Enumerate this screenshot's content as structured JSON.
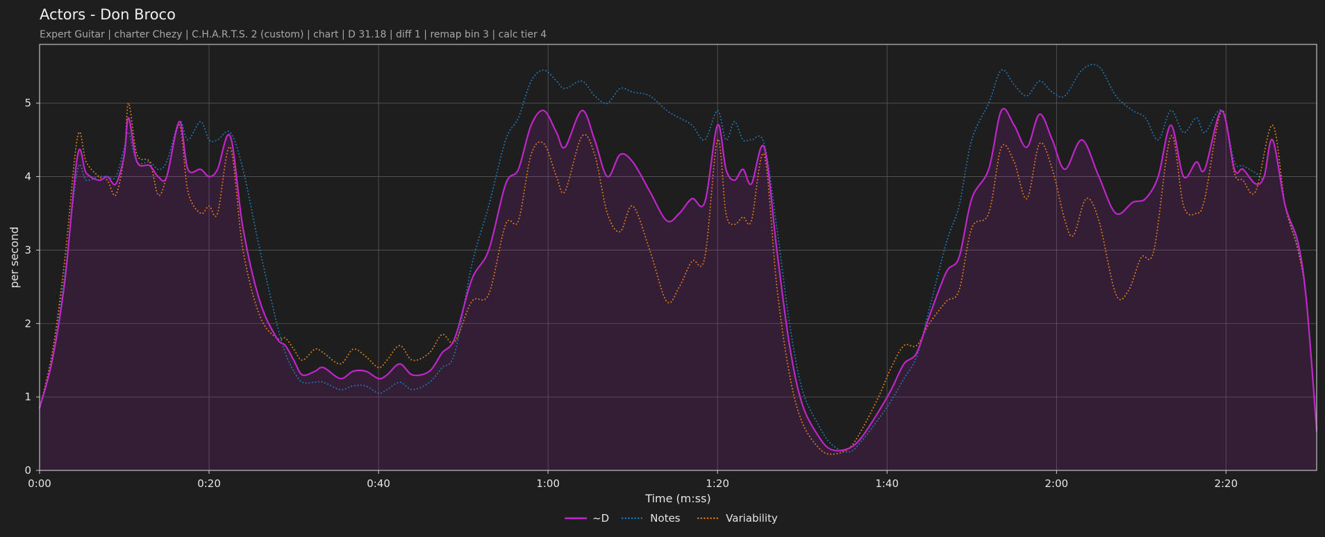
{
  "page": {
    "title": "Actors - Don Broco",
    "subtitle": "Expert Guitar  |  charter Chezy  |  C.H.A.R.T.S. 2 (custom)  |  chart  |  D 31.18  |  diff 1  |  remap bin 3  |  calc tier 4"
  },
  "chart_data": {
    "type": "line",
    "xlabel": "Time (m:ss)",
    "ylabel": "per second",
    "xlim": [
      0,
      150.7
    ],
    "ylim": [
      0,
      5.8
    ],
    "x_ticks": [
      0,
      20,
      40,
      60,
      80,
      100,
      120,
      140
    ],
    "x_tick_labels": [
      "0:00",
      "0:20",
      "0:40",
      "1:00",
      "1:20",
      "1:40",
      "2:00",
      "2:20"
    ],
    "y_ticks": [
      0,
      1,
      2,
      3,
      4,
      5
    ],
    "y_tick_labels": [
      "0",
      "1",
      "2",
      "3",
      "4",
      "5"
    ],
    "grid": true,
    "legend_position": "bottom-center",
    "series": [
      {
        "name": "~D",
        "color": "#c026c9",
        "style": "solid",
        "fill": true,
        "points": [
          [
            0,
            0.85
          ],
          [
            1.5,
            1.5
          ],
          [
            3,
            2.6
          ],
          [
            4.5,
            4.3
          ],
          [
            5.5,
            4.05
          ],
          [
            7,
            3.95
          ],
          [
            8,
            4.0
          ],
          [
            9,
            3.9
          ],
          [
            10,
            4.3
          ],
          [
            10.5,
            4.8
          ],
          [
            11.5,
            4.2
          ],
          [
            13,
            4.15
          ],
          [
            14,
            4.0
          ],
          [
            15,
            4.0
          ],
          [
            16.5,
            4.75
          ],
          [
            17.5,
            4.1
          ],
          [
            19,
            4.1
          ],
          [
            20,
            4.0
          ],
          [
            21,
            4.1
          ],
          [
            22.5,
            4.55
          ],
          [
            24,
            3.3
          ],
          [
            26,
            2.3
          ],
          [
            28,
            1.8
          ],
          [
            29,
            1.7
          ],
          [
            30,
            1.5
          ],
          [
            31,
            1.3
          ],
          [
            32.5,
            1.35
          ],
          [
            33.5,
            1.4
          ],
          [
            35.5,
            1.25
          ],
          [
            37,
            1.35
          ],
          [
            38.5,
            1.35
          ],
          [
            40,
            1.25
          ],
          [
            41,
            1.3
          ],
          [
            42.5,
            1.45
          ],
          [
            44,
            1.3
          ],
          [
            46,
            1.35
          ],
          [
            47.5,
            1.6
          ],
          [
            49,
            1.8
          ],
          [
            51,
            2.6
          ],
          [
            53,
            3.0
          ],
          [
            55,
            3.9
          ],
          [
            56.5,
            4.1
          ],
          [
            58,
            4.7
          ],
          [
            59.5,
            4.9
          ],
          [
            61,
            4.6
          ],
          [
            62,
            4.4
          ],
          [
            64,
            4.9
          ],
          [
            65.5,
            4.5
          ],
          [
            67,
            4.0
          ],
          [
            68.5,
            4.3
          ],
          [
            70,
            4.2
          ],
          [
            72,
            3.8
          ],
          [
            74,
            3.4
          ],
          [
            75.5,
            3.5
          ],
          [
            77,
            3.7
          ],
          [
            78.5,
            3.65
          ],
          [
            80,
            4.7
          ],
          [
            81,
            4.1
          ],
          [
            82,
            3.95
          ],
          [
            83,
            4.1
          ],
          [
            84,
            3.9
          ],
          [
            85.5,
            4.4
          ],
          [
            87,
            3.0
          ],
          [
            88.5,
            1.7
          ],
          [
            90,
            0.9
          ],
          [
            92,
            0.45
          ],
          [
            93.5,
            0.28
          ],
          [
            95.5,
            0.3
          ],
          [
            97,
            0.45
          ],
          [
            99,
            0.8
          ],
          [
            100.5,
            1.1
          ],
          [
            102,
            1.45
          ],
          [
            103.5,
            1.6
          ],
          [
            105,
            2.1
          ],
          [
            107,
            2.7
          ],
          [
            108.5,
            2.9
          ],
          [
            110,
            3.7
          ],
          [
            112,
            4.1
          ],
          [
            113.5,
            4.9
          ],
          [
            115,
            4.7
          ],
          [
            116.5,
            4.4
          ],
          [
            118,
            4.85
          ],
          [
            119.5,
            4.5
          ],
          [
            121,
            4.1
          ],
          [
            123,
            4.5
          ],
          [
            125,
            4.0
          ],
          [
            127,
            3.5
          ],
          [
            129,
            3.65
          ],
          [
            130.5,
            3.7
          ],
          [
            132,
            4.0
          ],
          [
            133.5,
            4.7
          ],
          [
            135,
            4.0
          ],
          [
            136.5,
            4.2
          ],
          [
            137.5,
            4.1
          ],
          [
            139.5,
            4.9
          ],
          [
            141,
            4.1
          ],
          [
            142,
            4.1
          ],
          [
            143.5,
            3.9
          ],
          [
            144.5,
            4.0
          ],
          [
            145.5,
            4.5
          ],
          [
            147,
            3.6
          ],
          [
            148.5,
            3.1
          ],
          [
            149.5,
            2.3
          ],
          [
            150.7,
            0.55
          ]
        ]
      },
      {
        "name": "Notes",
        "color": "#1f77b4",
        "style": "dotted",
        "fill": false,
        "points": [
          [
            0,
            0.85
          ],
          [
            1.5,
            1.6
          ],
          [
            3,
            2.7
          ],
          [
            4.5,
            4.1
          ],
          [
            5.5,
            3.95
          ],
          [
            7,
            4.0
          ],
          [
            8,
            4.0
          ],
          [
            9,
            4.0
          ],
          [
            10,
            4.4
          ],
          [
            10.5,
            4.6
          ],
          [
            11.5,
            4.2
          ],
          [
            13,
            4.2
          ],
          [
            14,
            4.1
          ],
          [
            15,
            4.2
          ],
          [
            16.5,
            4.75
          ],
          [
            17.5,
            4.5
          ],
          [
            19,
            4.75
          ],
          [
            20,
            4.5
          ],
          [
            21,
            4.5
          ],
          [
            22.5,
            4.6
          ],
          [
            24,
            4.1
          ],
          [
            26,
            3.0
          ],
          [
            28,
            2.0
          ],
          [
            29,
            1.6
          ],
          [
            30,
            1.35
          ],
          [
            31,
            1.2
          ],
          [
            32.5,
            1.2
          ],
          [
            33.5,
            1.2
          ],
          [
            35.5,
            1.1
          ],
          [
            37,
            1.15
          ],
          [
            38.5,
            1.15
          ],
          [
            40,
            1.05
          ],
          [
            41,
            1.1
          ],
          [
            42.5,
            1.2
          ],
          [
            44,
            1.1
          ],
          [
            46,
            1.2
          ],
          [
            47.5,
            1.4
          ],
          [
            49,
            1.6
          ],
          [
            51,
            2.8
          ],
          [
            53,
            3.6
          ],
          [
            55,
            4.5
          ],
          [
            56.5,
            4.8
          ],
          [
            58,
            5.3
          ],
          [
            59.5,
            5.45
          ],
          [
            61,
            5.3
          ],
          [
            62,
            5.2
          ],
          [
            64,
            5.3
          ],
          [
            65.5,
            5.1
          ],
          [
            67,
            5.0
          ],
          [
            68.5,
            5.2
          ],
          [
            70,
            5.15
          ],
          [
            72,
            5.1
          ],
          [
            74,
            4.9
          ],
          [
            75.5,
            4.8
          ],
          [
            77,
            4.7
          ],
          [
            78.5,
            4.5
          ],
          [
            80,
            4.9
          ],
          [
            81,
            4.5
          ],
          [
            82,
            4.75
          ],
          [
            83,
            4.5
          ],
          [
            84,
            4.5
          ],
          [
            85.5,
            4.45
          ],
          [
            87,
            3.3
          ],
          [
            88.5,
            2.0
          ],
          [
            90,
            1.1
          ],
          [
            92,
            0.6
          ],
          [
            93.5,
            0.35
          ],
          [
            95.5,
            0.25
          ],
          [
            97,
            0.4
          ],
          [
            99,
            0.7
          ],
          [
            100.5,
            0.95
          ],
          [
            102,
            1.25
          ],
          [
            103.5,
            1.55
          ],
          [
            105,
            2.2
          ],
          [
            107,
            3.1
          ],
          [
            108.5,
            3.6
          ],
          [
            110,
            4.5
          ],
          [
            112,
            5.0
          ],
          [
            113.5,
            5.45
          ],
          [
            115,
            5.25
          ],
          [
            116.5,
            5.1
          ],
          [
            118,
            5.3
          ],
          [
            119.5,
            5.15
          ],
          [
            121,
            5.1
          ],
          [
            123,
            5.45
          ],
          [
            125,
            5.5
          ],
          [
            127,
            5.1
          ],
          [
            129,
            4.9
          ],
          [
            130.5,
            4.8
          ],
          [
            132,
            4.5
          ],
          [
            133.5,
            4.9
          ],
          [
            135,
            4.6
          ],
          [
            136.5,
            4.8
          ],
          [
            137.5,
            4.6
          ],
          [
            139.5,
            4.9
          ],
          [
            141,
            4.2
          ],
          [
            142,
            4.15
          ],
          [
            143.5,
            4.05
          ],
          [
            144.5,
            4.0
          ],
          [
            145.5,
            4.5
          ],
          [
            147,
            3.6
          ],
          [
            148.5,
            3.0
          ],
          [
            149.5,
            2.3
          ],
          [
            150.7,
            0.5
          ]
        ]
      },
      {
        "name": "Variability",
        "color": "#e07b1a",
        "style": "dotted",
        "fill": false,
        "points": [
          [
            0,
            0.85
          ],
          [
            1.5,
            1.6
          ],
          [
            3,
            2.9
          ],
          [
            4.5,
            4.55
          ],
          [
            5.5,
            4.2
          ],
          [
            7,
            4.0
          ],
          [
            8,
            3.95
          ],
          [
            9,
            3.75
          ],
          [
            10,
            4.3
          ],
          [
            10.5,
            5.0
          ],
          [
            11.5,
            4.3
          ],
          [
            13,
            4.2
          ],
          [
            14,
            3.75
          ],
          [
            15,
            4.0
          ],
          [
            16.5,
            4.7
          ],
          [
            17.5,
            3.8
          ],
          [
            19,
            3.5
          ],
          [
            20,
            3.6
          ],
          [
            21,
            3.5
          ],
          [
            22.5,
            4.4
          ],
          [
            24,
            3.0
          ],
          [
            26,
            2.1
          ],
          [
            28,
            1.8
          ],
          [
            29,
            1.8
          ],
          [
            30,
            1.65
          ],
          [
            31,
            1.5
          ],
          [
            32.5,
            1.65
          ],
          [
            33.5,
            1.6
          ],
          [
            35.5,
            1.45
          ],
          [
            37,
            1.65
          ],
          [
            38.5,
            1.55
          ],
          [
            40,
            1.4
          ],
          [
            41,
            1.5
          ],
          [
            42.5,
            1.7
          ],
          [
            44,
            1.5
          ],
          [
            46,
            1.6
          ],
          [
            47.5,
            1.85
          ],
          [
            49,
            1.75
          ],
          [
            51,
            2.3
          ],
          [
            53,
            2.4
          ],
          [
            55,
            3.35
          ],
          [
            56.5,
            3.4
          ],
          [
            58,
            4.3
          ],
          [
            59.5,
            4.45
          ],
          [
            61,
            4.0
          ],
          [
            62,
            3.8
          ],
          [
            64,
            4.55
          ],
          [
            65.5,
            4.3
          ],
          [
            67,
            3.5
          ],
          [
            68.5,
            3.25
          ],
          [
            70,
            3.6
          ],
          [
            72,
            3.0
          ],
          [
            74,
            2.3
          ],
          [
            75.5,
            2.5
          ],
          [
            77,
            2.85
          ],
          [
            78.5,
            2.9
          ],
          [
            80,
            4.5
          ],
          [
            81,
            3.5
          ],
          [
            82,
            3.35
          ],
          [
            83,
            3.45
          ],
          [
            84,
            3.4
          ],
          [
            85.5,
            4.3
          ],
          [
            87,
            2.5
          ],
          [
            88.5,
            1.3
          ],
          [
            90,
            0.65
          ],
          [
            92,
            0.3
          ],
          [
            93.5,
            0.22
          ],
          [
            95.5,
            0.3
          ],
          [
            97,
            0.55
          ],
          [
            99,
            1.0
          ],
          [
            100.5,
            1.4
          ],
          [
            102,
            1.7
          ],
          [
            103.5,
            1.7
          ],
          [
            105,
            2.0
          ],
          [
            107,
            2.3
          ],
          [
            108.5,
            2.45
          ],
          [
            110,
            3.3
          ],
          [
            112,
            3.5
          ],
          [
            113.5,
            4.4
          ],
          [
            115,
            4.2
          ],
          [
            116.5,
            3.7
          ],
          [
            118,
            4.45
          ],
          [
            119.5,
            4.1
          ],
          [
            121,
            3.4
          ],
          [
            122,
            3.2
          ],
          [
            123.5,
            3.7
          ],
          [
            125,
            3.4
          ],
          [
            127,
            2.4
          ],
          [
            128.5,
            2.45
          ],
          [
            130,
            2.9
          ],
          [
            131.5,
            3.0
          ],
          [
            133.5,
            4.55
          ],
          [
            135,
            3.6
          ],
          [
            136.5,
            3.5
          ],
          [
            137.5,
            3.7
          ],
          [
            139.5,
            4.9
          ],
          [
            141,
            4.05
          ],
          [
            142,
            3.95
          ],
          [
            143.5,
            3.8
          ],
          [
            145.5,
            4.7
          ],
          [
            147,
            3.6
          ],
          [
            148.5,
            3.0
          ],
          [
            149.5,
            2.3
          ],
          [
            150.7,
            0.55
          ]
        ]
      }
    ]
  }
}
